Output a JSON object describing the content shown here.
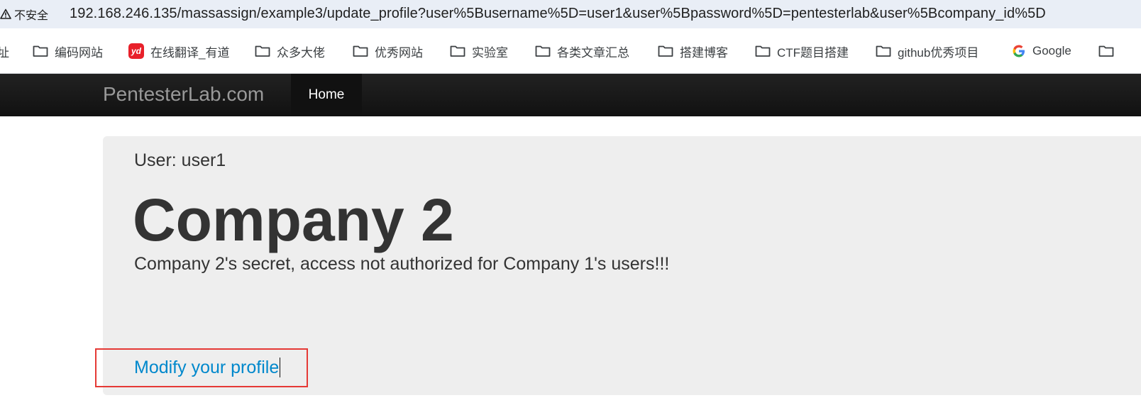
{
  "browser": {
    "security_label": "不安全",
    "url": "192.168.246.135/massassign/example3/update_profile?user%5Busername%5D=user1&user%5Bpassword%5D=pentesterlab&user%5Bcompany_id%5D",
    "left_fragment": "址"
  },
  "bookmarks": [
    {
      "label": "编码网站",
      "icon": "folder-icon"
    },
    {
      "label": "在线翻译_有道",
      "icon": "youdao-icon"
    },
    {
      "label": "众多大佬",
      "icon": "folder-icon"
    },
    {
      "label": "优秀网站",
      "icon": "folder-icon"
    },
    {
      "label": "实验室",
      "icon": "folder-icon"
    },
    {
      "label": "各类文章汇总",
      "icon": "folder-icon"
    },
    {
      "label": "搭建博客",
      "icon": "folder-icon"
    },
    {
      "label": "CTF题目搭建",
      "icon": "folder-icon"
    },
    {
      "label": "github优秀项目",
      "icon": "folder-icon"
    },
    {
      "label": "Google",
      "icon": "google-icon"
    }
  ],
  "youdao_badge": "yd",
  "navbar": {
    "brand": "PentesterLab.com",
    "home_label": "Home"
  },
  "content": {
    "user_line": "User: user1",
    "company_title": "Company 2",
    "secret_text": "Company 2's secret, access not authorized for Company 1's users!!!",
    "modify_link": "Modify your profile"
  },
  "colors": {
    "link": "#0088cc",
    "highlight": "#e53935",
    "navbar": "#1b1b1b",
    "hero_bg": "#eeeeee"
  }
}
